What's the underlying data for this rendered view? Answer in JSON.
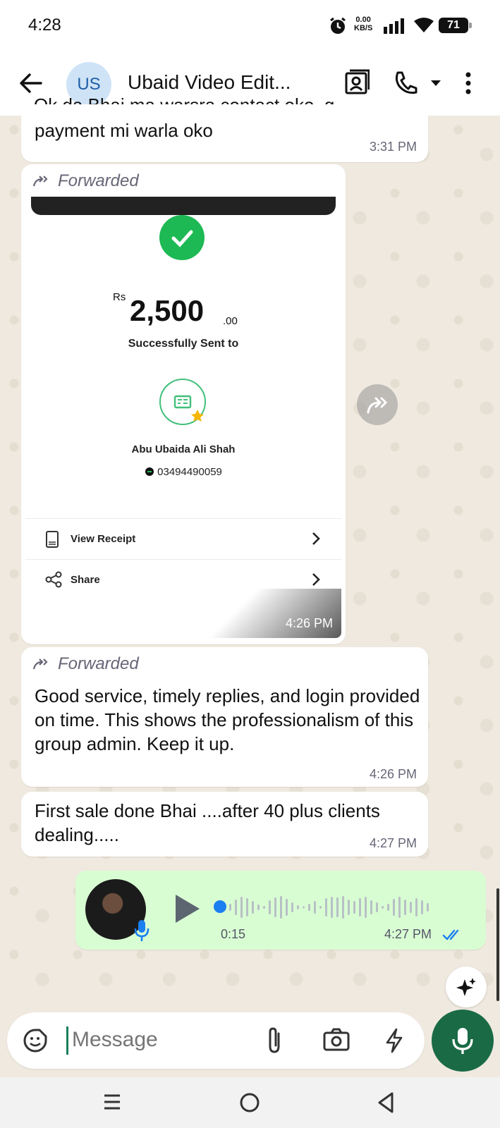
{
  "status_bar": {
    "time": "4:28",
    "net_speed_value": "0.00",
    "net_speed_unit": "KB/S",
    "battery": "71",
    "icons": [
      "alarm-icon",
      "signal-icon",
      "wifi-icon",
      "battery-icon"
    ]
  },
  "header": {
    "avatar_initials": "US",
    "title": "Ubaid Video Edit...",
    "icons": [
      "back-arrow-icon",
      "contact-card-icon",
      "phone-icon",
      "dropdown-caret-icon",
      "more-vert-icon"
    ]
  },
  "messages": {
    "m1": {
      "cut_text": "Ok da Bhai ma warsra contact oko..g...",
      "text": "payment mi warla oko",
      "time": "3:31 PM"
    },
    "m2": {
      "forwarded_label": "Forwarded",
      "time": "4:26 PM",
      "receipt": {
        "currency": "Rs",
        "amount": "2,500",
        "decimals": ".00",
        "sent_label": "Successfully Sent to",
        "recipient_name": "Abu Ubaida Ali Shah",
        "recipient_phone": "03494490059",
        "view_receipt": "View Receipt",
        "share": "Share"
      }
    },
    "m3": {
      "forwarded_label": "Forwarded",
      "text": "Good service, timely replies, and login provided on time. This shows the professionalism of this group admin. Keep it up.",
      "time": "4:26 PM"
    },
    "m4": {
      "text": "First sale done Bhai ....after 40 plus clients  dealing.....",
      "time": "4:27 PM"
    },
    "voice": {
      "duration": "0:15",
      "time": "4:27 PM",
      "progress": 0
    }
  },
  "composer": {
    "placeholder": "Message"
  },
  "colors": {
    "outgoing_bubble": "#d9fdd3",
    "mic_button": "#1a6b45",
    "read_ticks": "#1a7ff0"
  }
}
